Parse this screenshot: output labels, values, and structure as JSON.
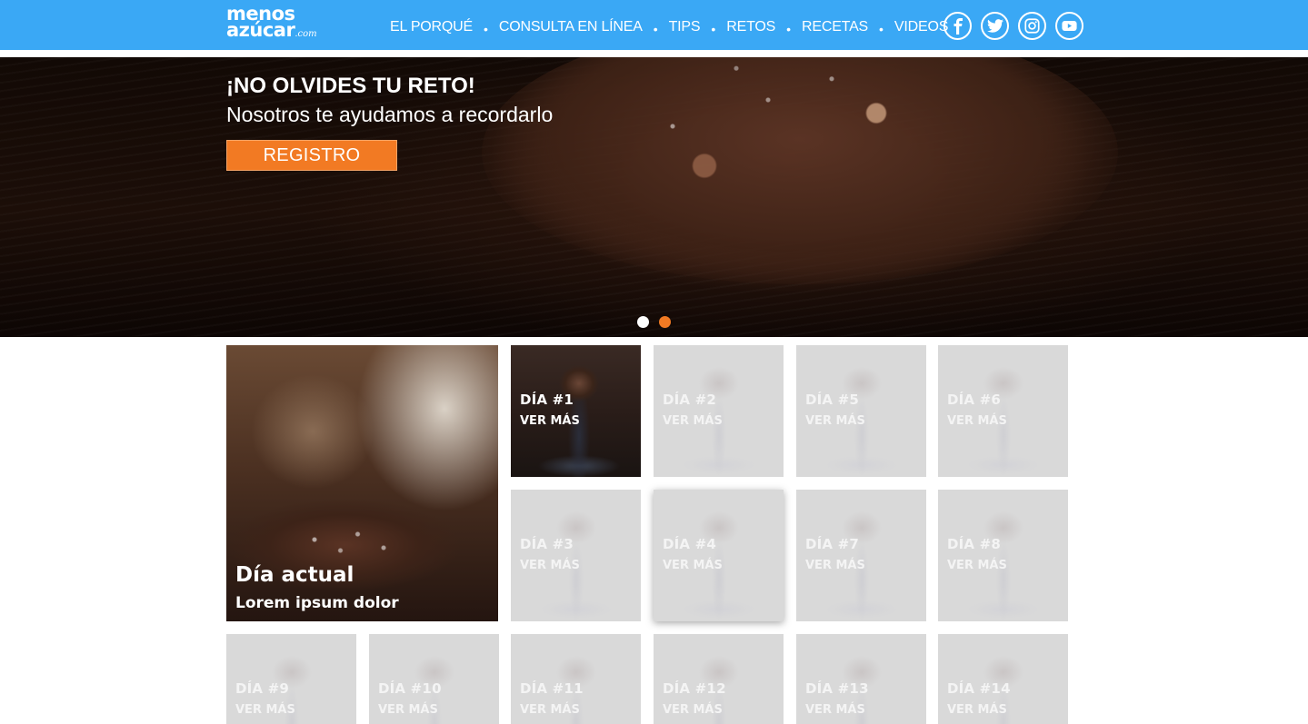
{
  "brand": {
    "logo_line1": "menos",
    "logo_line2": "azúcar",
    "logo_suffix": ".com",
    "header_color": "#3aa8f5",
    "accent_color": "#f27a23"
  },
  "nav": {
    "items": [
      {
        "label": "EL PORQUÉ"
      },
      {
        "label": "CONSULTA EN LÍNEA"
      },
      {
        "label": "TIPS"
      },
      {
        "label": "RETOS"
      },
      {
        "label": "RECETAS"
      },
      {
        "label": "VIDEOS"
      }
    ],
    "separator": "•"
  },
  "social": [
    {
      "icon": "facebook-icon"
    },
    {
      "icon": "twitter-icon"
    },
    {
      "icon": "instagram-icon"
    },
    {
      "icon": "youtube-icon"
    }
  ],
  "hero": {
    "title": "¡NO OLVIDES TU RETO!",
    "subtitle": "Nosotros te ayudamos a recordarlo",
    "button_label": "REGISTRO",
    "slides": 2,
    "active_slide": 2
  },
  "feature": {
    "title": "Día actual",
    "subtitle": "Lorem ipsum dolor"
  },
  "days": [
    {
      "title": "DÍA #1",
      "more": "VER MÁS",
      "state": "active"
    },
    {
      "title": "DÍA #2",
      "more": "VER MÁS",
      "state": "locked"
    },
    {
      "title": "DÍA #5",
      "more": "VER MÁS",
      "state": "locked"
    },
    {
      "title": "DÍA #6",
      "more": "VER MÁS",
      "state": "locked"
    },
    {
      "title": "DÍA #3",
      "more": "VER MÁS",
      "state": "locked"
    },
    {
      "title": "DÍA #4",
      "more": "VER MÁS",
      "state": "hover"
    },
    {
      "title": "DÍA #7",
      "more": "VER MÁS",
      "state": "locked"
    },
    {
      "title": "DÍA #8",
      "more": "VER MÁS",
      "state": "locked"
    },
    {
      "title": "DÍA #9",
      "more": "VER MÁS",
      "state": "locked"
    },
    {
      "title": "DÍA #10",
      "more": "VER MÁS",
      "state": "locked"
    },
    {
      "title": "DÍA #11",
      "more": "VER MÁS",
      "state": "locked"
    },
    {
      "title": "DÍA #12",
      "more": "VER MÁS",
      "state": "locked"
    },
    {
      "title": "DÍA #13",
      "more": "VER MÁS",
      "state": "locked"
    },
    {
      "title": "DÍA #14",
      "more": "VER MÁS",
      "state": "locked"
    }
  ]
}
